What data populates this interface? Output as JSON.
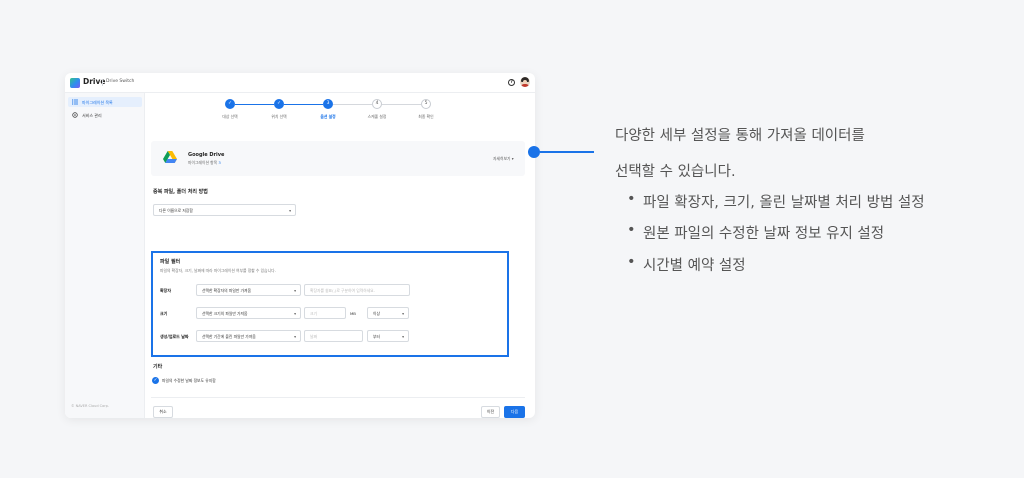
{
  "app": {
    "brand": "Drive",
    "subtitle": "Drive Switch",
    "help_icon": "help-icon",
    "avatar_icon": "user-avatar"
  },
  "sidebar": {
    "items": [
      {
        "label": "마이그레이션 목록",
        "icon": "list-icon",
        "active": true
      },
      {
        "label": "서비스 관리",
        "icon": "settings-icon",
        "active": false
      }
    ],
    "footer": "© NAVER Cloud Corp."
  },
  "stepper": {
    "steps": [
      {
        "label": "대상 선택",
        "state": "done",
        "num": "1"
      },
      {
        "label": "위치 선택",
        "state": "done",
        "num": "2"
      },
      {
        "label": "옵션 설정",
        "state": "current",
        "num": "3"
      },
      {
        "label": "스케줄 설정",
        "state": "todo",
        "num": "4"
      },
      {
        "label": "최종 확인",
        "state": "todo",
        "num": "5"
      }
    ]
  },
  "source": {
    "name": "Google Drive",
    "sub_prefix": "마이그레이션 항목 ",
    "sub_count": "3",
    "detail_label": "자세히보기",
    "detail_icon": "chevron-down-icon"
  },
  "duplicate": {
    "title": "중복 파일, 폴더 처리 방법",
    "select_value": "다른 이름으로 저장함"
  },
  "filter": {
    "title": "파일 필터",
    "description": "파일의 확장자, 크기, 날짜에 따라 마이그레이션 여부를 정할 수 있습니다.",
    "extension": {
      "label": "확장자",
      "select_value": "선택한 확장자의 파일만 가져옴",
      "placeholder": "확장자를 쉼표(,)로 구분하여 입력하세요."
    },
    "size": {
      "label": "크기",
      "select_value": "선택한 크기의 파일만 가져옴",
      "placeholder": "크기",
      "unit": "MB",
      "condition": "이상"
    },
    "date": {
      "label": "생성/업로드 날짜",
      "select_value": "선택한 기간에 올린 파일만 가져옴",
      "placeholder": "날짜",
      "condition": "부터"
    }
  },
  "etc": {
    "title": "기타",
    "checkbox_label": "파일의 수정한 날짜 정보도 유지함",
    "checked": true
  },
  "actions": {
    "cancel": "취소",
    "prev": "이전",
    "next": "다음"
  },
  "callout": {
    "line1": "다양한 세부 설정을 통해 가져올 데이터를",
    "line2": "선택할 수 있습니다.",
    "bullets": [
      "파일 확장자, 크기, 올린 날짜별 처리 방법 설정",
      "원본 파일의 수정한 날짜 정보 유지 설정",
      "시간별 예약 설정"
    ]
  },
  "colors": {
    "accent": "#1a73e8",
    "background": "#f5f6f8"
  }
}
